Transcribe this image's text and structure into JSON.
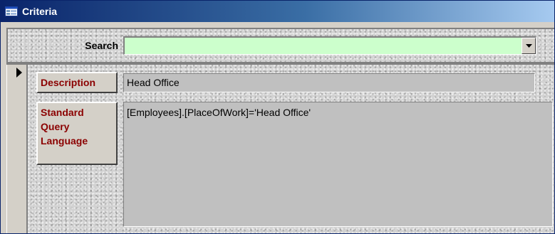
{
  "window": {
    "title": "Criteria",
    "icon": "form-icon",
    "titlebar_color": "#0a246a"
  },
  "search": {
    "label": "Search",
    "value": "",
    "field_color": "#ccffcc",
    "dropdown_icon": "chevron-down-icon"
  },
  "record": {
    "selector_icon": "record-pointer-icon",
    "description": {
      "label": "Description",
      "value": "Head Office"
    },
    "sql": {
      "label_lines": [
        "Standard",
        "Query",
        "Language"
      ],
      "value": "[Employees].[PlaceOfWork]='Head Office'"
    },
    "label_color": "#8b0000"
  }
}
